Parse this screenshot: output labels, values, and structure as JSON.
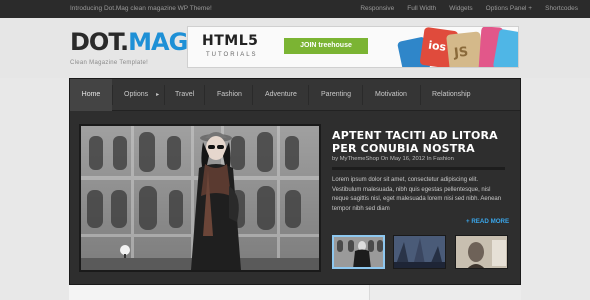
{
  "topbar": {
    "intro": "Introducing Dot.Mag clean magazine WP Theme!",
    "links": [
      "Responsive",
      "Full Width",
      "Widgets",
      "Options Panel +",
      "Shortcodes"
    ]
  },
  "header": {
    "logo_dark": "DOT.",
    "logo_blue": "MAG",
    "tagline": "Clean Magazine Template!"
  },
  "banner": {
    "html5": "HTML5",
    "tutorials": "TUTORIALS",
    "join": "JOIN treehouse",
    "tags": [
      "ios",
      "JS"
    ]
  },
  "nav": {
    "items": [
      "Home",
      "Options",
      "Travel",
      "Fashion",
      "Adventure",
      "Parenting",
      "Motivation",
      "Relationship"
    ],
    "options_arrow": "▸"
  },
  "featured": {
    "title": "APTENT TACITI AD LITORA PER CONUBIA NOSTRA",
    "byline": "by MyThemeShop On May 16, 2012 In Fashion",
    "excerpt": "Lorem ipsum dolor sit amet, consectetur adipiscing elit. Vestibulum malesuada, nibh quis egestas pellentesque, nisl neque sagittis nisl, eget malesuada lorem nisi sed nibh. Aenean tempor nibh sed diam",
    "read_more": "+ READ MORE"
  },
  "colors": {
    "accent": "#1e90d6",
    "read_more": "#3aa6ea",
    "join_green": "#7bb433",
    "panel_bg": "#2e2e2e"
  }
}
